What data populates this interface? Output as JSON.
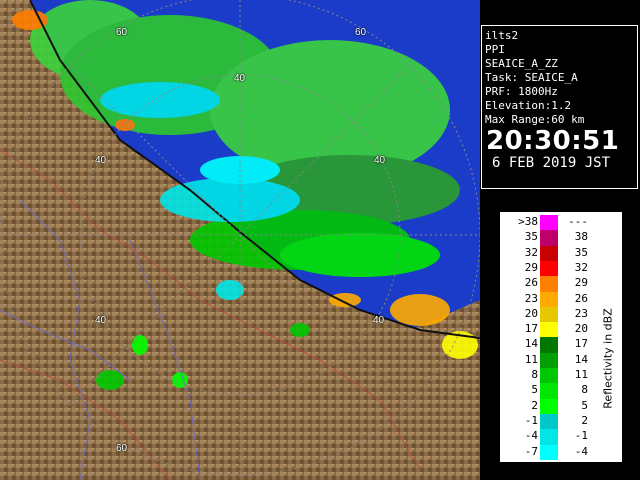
{
  "info": {
    "lines": [
      "ilts2",
      "PPI",
      "SEAICE_A_ZZ",
      "Task: SEAICE_A",
      "PRF: 1800Hz",
      "Elevation:1.2",
      "Max Range:60 km"
    ],
    "time": "20:30:51",
    "date": "6 FEB 2019 JST"
  },
  "range_labels": [
    "60",
    "60",
    "40",
    "40",
    "40",
    "40",
    "40",
    "60"
  ],
  "legend": {
    "title": "Reflectivity in dBZ",
    "rows": [
      {
        "low": ">38",
        "high": "---",
        "color": "#ff00ff"
      },
      {
        "low": "35",
        "high": "38",
        "color": "#c0006a"
      },
      {
        "low": "32",
        "high": "35",
        "color": "#c80000"
      },
      {
        "low": "29",
        "high": "32",
        "color": "#ff0000"
      },
      {
        "low": "26",
        "high": "29",
        "color": "#ff7f00"
      },
      {
        "low": "23",
        "high": "26",
        "color": "#ffaa00"
      },
      {
        "low": "20",
        "high": "23",
        "color": "#e6c800"
      },
      {
        "low": "17",
        "high": "20",
        "color": "#ffff00"
      },
      {
        "low": "14",
        "high": "17",
        "color": "#007800"
      },
      {
        "low": "11",
        "high": "14",
        "color": "#00a000"
      },
      {
        "low": "8",
        "high": "11",
        "color": "#00c800"
      },
      {
        "low": "5",
        "high": "8",
        "color": "#00e600"
      },
      {
        "low": "2",
        "high": "5",
        "color": "#00ff00"
      },
      {
        "low": "-1",
        "high": "2",
        "color": "#00c8c8"
      },
      {
        "low": "-4",
        "high": "-1",
        "color": "#00e6e6"
      },
      {
        "low": "-7",
        "high": "-4",
        "color": "#00ffff"
      }
    ]
  },
  "colors": {
    "sea": "#1a3cc8",
    "land": "#8b6b45",
    "echo": "#3cd23c",
    "ring": "#888888"
  }
}
